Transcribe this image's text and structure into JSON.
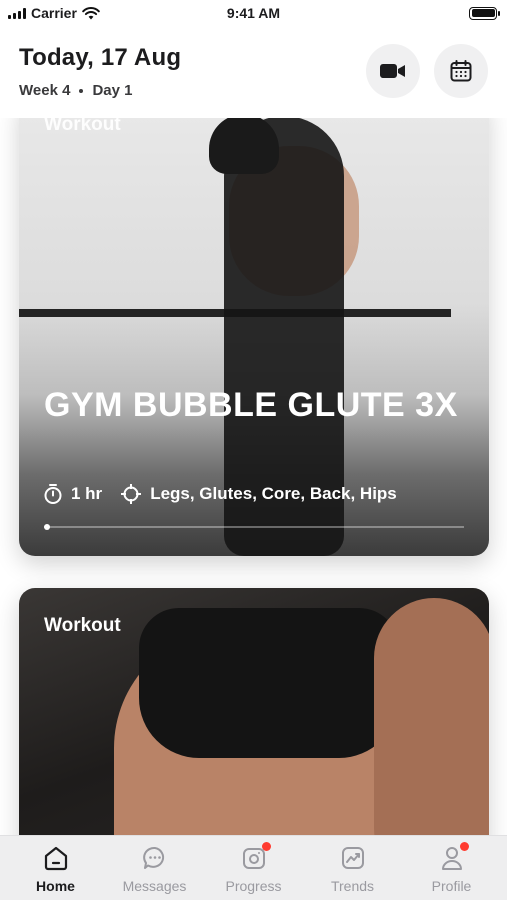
{
  "status_bar": {
    "carrier": "Carrier",
    "time": "9:41 AM"
  },
  "header": {
    "date": "Today, 17 Aug",
    "week": "Week 4",
    "day": "Day 1",
    "video_icon": "video-camera-icon",
    "calendar_icon": "calendar-icon"
  },
  "cards": [
    {
      "label": "Workout",
      "title": "GYM BUBBLE GLUTE 3X",
      "duration": "1 hr",
      "focus": "Legs, Glutes, Core, Back, Hips",
      "progress": 0.0
    },
    {
      "label": "Workout"
    }
  ],
  "tabs": [
    {
      "label": "Home",
      "icon": "home-icon",
      "active": true
    },
    {
      "label": "Messages",
      "icon": "chat-icon"
    },
    {
      "label": "Progress",
      "icon": "camera-icon",
      "badge": true
    },
    {
      "label": "Trends",
      "icon": "trend-chart-icon"
    },
    {
      "label": "Profile",
      "icon": "user-icon",
      "badge": true
    }
  ],
  "colors": {
    "badge": "#ff3b30",
    "tabbar_bg": "#eeeeef",
    "active_tab": "#1c1c1e",
    "inactive_tab": "#9a9aa0"
  }
}
